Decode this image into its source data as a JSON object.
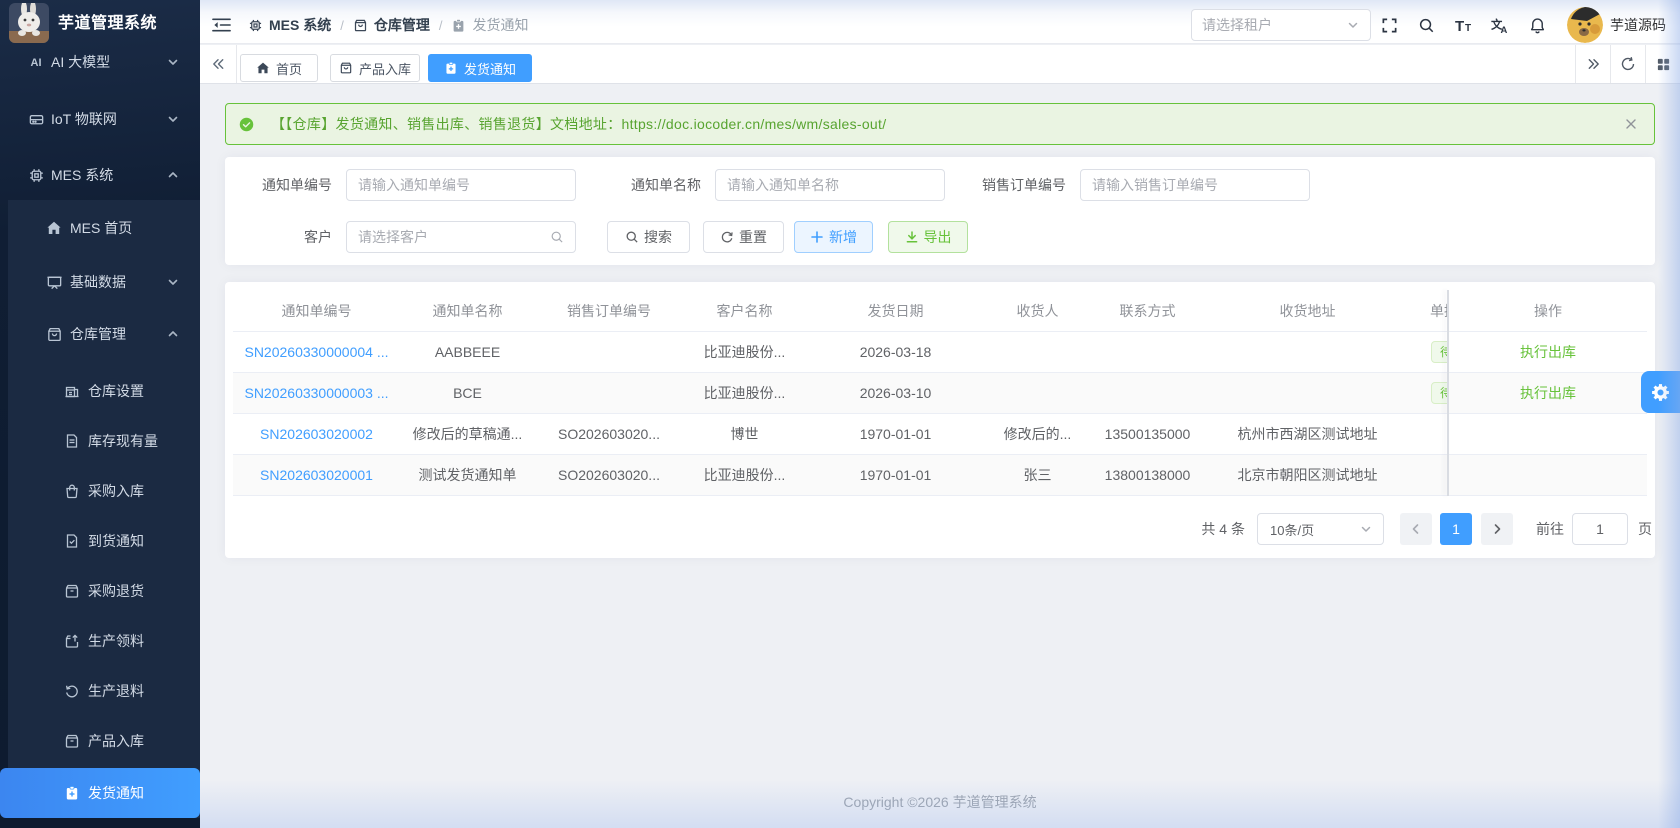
{
  "app": {
    "title": "芋道管理系统",
    "footer": "Copyright ©2026 芋道管理系统"
  },
  "colors": {
    "primary": "#409eff",
    "success": "#67c23a",
    "sidebar_bg": "#0e1c31",
    "sidebar_submenu_bg": "#1b2a42",
    "content_bg": "#f0f2f5"
  },
  "sidebar": {
    "logo_title": "芋道管理系统",
    "menu": [
      {
        "label": "AI 大模型",
        "icon": "ai-icon",
        "arrow": "down"
      },
      {
        "label": "IoT 物联网",
        "icon": "iot-device-icon",
        "arrow": "down"
      },
      {
        "label": "MES 系统",
        "icon": "cpu-chip-icon",
        "arrow": "up"
      },
      {
        "label": "MES 首页",
        "icon": "home-icon"
      },
      {
        "label": "基础数据",
        "icon": "presentation-board-icon",
        "arrow": "down"
      },
      {
        "label": "仓库管理",
        "icon": "package-box-icon",
        "arrow": "up"
      },
      {
        "label": "仓库设置",
        "icon": "building-icon"
      },
      {
        "label": "库存现有量",
        "icon": "document-icon"
      },
      {
        "label": "采购入库",
        "icon": "handbag-icon"
      },
      {
        "label": "到货通知",
        "icon": "document-check-icon"
      },
      {
        "label": "采购退货",
        "icon": "box-icon"
      },
      {
        "label": "生产领料",
        "icon": "box-arrow-up-icon"
      },
      {
        "label": "生产退料",
        "icon": "rotate-ccw-icon"
      },
      {
        "label": "产品入库",
        "icon": "box-icon"
      },
      {
        "label": "发货通知",
        "icon": "clipboard-plus-icon",
        "active": true
      }
    ]
  },
  "header": {
    "breadcrumb": [
      {
        "label": "MES 系统",
        "icon": "cpu-chip-icon"
      },
      {
        "label": "仓库管理",
        "icon": "package-box-icon"
      },
      {
        "label": "发货通知",
        "icon": "clipboard-icon"
      }
    ],
    "separator": "/",
    "tenant_placeholder": "请选择租户",
    "action_icons": [
      "fullscreen-icon",
      "search-icon",
      "font-size-icon",
      "translate-icon",
      "bell-icon"
    ],
    "username": "芋道源码"
  },
  "tabbar": {
    "tabs": [
      {
        "label": "首页",
        "icon": "home-icon"
      },
      {
        "label": "产品入库",
        "icon": "package-box-icon"
      },
      {
        "label": "发货通知",
        "icon": "clipboard-plus-icon",
        "active": true
      }
    ]
  },
  "alert": {
    "text": "【【仓库】发货通知、销售出库、销售退货】文档地址：",
    "url_text": "https://doc.iocoder.cn/mes/wm/sales-out/"
  },
  "filters": {
    "fields": [
      {
        "label": "通知单编号",
        "placeholder": "请输入通知单编号"
      },
      {
        "label": "通知单名称",
        "placeholder": "请输入通知单名称"
      },
      {
        "label": "销售订单编号",
        "placeholder": "请输入销售订单编号"
      },
      {
        "label": "客户",
        "placeholder": "请选择客户"
      }
    ],
    "buttons": {
      "search": "搜索",
      "reset": "重置",
      "create": "新增",
      "export": "导出"
    }
  },
  "table": {
    "columns": [
      "通知单编号",
      "通知单名称",
      "销售订单编号",
      "客户名称",
      "发货日期",
      "收货人",
      "联系方式",
      "收货地址",
      "单据状态",
      "操作"
    ],
    "rows": [
      {
        "code": "SN20260330000004 ...",
        "name": "AABBEEE",
        "so": "",
        "customer": "比亚迪股份...",
        "date": "2026-03-18",
        "consignee": "",
        "phone": "",
        "address": "",
        "status": "待出库",
        "action": "执行出库"
      },
      {
        "code": "SN20260330000003 ...",
        "name": "BCE",
        "so": "",
        "customer": "比亚迪股份...",
        "date": "2026-03-10",
        "consignee": "",
        "phone": "",
        "address": "",
        "status": "待出库",
        "action": "执行出库"
      },
      {
        "code": "SN202603020002",
        "name": "修改后的草稿通...",
        "so": "SO202603020...",
        "customer": "博世",
        "date": "1970-01-01",
        "consignee": "修改后的...",
        "phone": "13500135000",
        "address": "杭州市西湖区测试地址",
        "status": "",
        "action": ""
      },
      {
        "code": "SN202603020001",
        "name": "测试发货通知单",
        "so": "SO202603020...",
        "customer": "比亚迪股份...",
        "date": "1970-01-01",
        "consignee": "张三",
        "phone": "13800138000",
        "address": "北京市朝阳区测试地址",
        "status": "",
        "action": ""
      }
    ]
  },
  "pagination": {
    "total_text": "共 4 条",
    "page_size": "10条/页",
    "current_page": "1",
    "goto_label": "前往",
    "goto_value": "1",
    "page_suffix": "页"
  }
}
